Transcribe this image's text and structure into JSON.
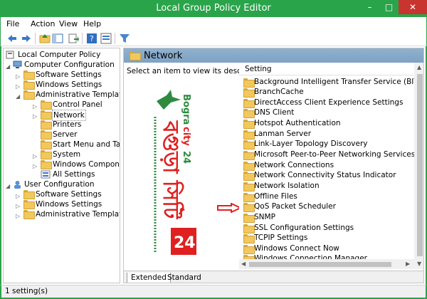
{
  "window": {
    "title": "Local Group Policy Editor",
    "minimize": "–",
    "maximize": "□",
    "close": "✕"
  },
  "menu": [
    {
      "label": "File"
    },
    {
      "label": "Action"
    },
    {
      "label": "View"
    },
    {
      "label": "Help"
    }
  ],
  "toolbar_icons": [
    "back-icon",
    "forward-icon",
    "up-folder-icon",
    "show-hide-tree-icon",
    "export-list-icon",
    "help-icon",
    "properties-icon",
    "filter-icon"
  ],
  "tree": {
    "root": "Local Computer Policy",
    "computer_config": "Computer Configuration",
    "cc_software": "Software Settings",
    "cc_windows": "Windows Settings",
    "cc_admin": "Administrative Templates",
    "control_panel": "Control Panel",
    "network": "Network",
    "printers": "Printers",
    "server": "Server",
    "start_menu": "Start Menu and Taskbar",
    "system": "System",
    "windows_components": "Windows Components",
    "all_settings": "All Settings",
    "user_config": "User Configuration",
    "uc_software": "Software Settings",
    "uc_windows": "Windows Settings",
    "uc_admin": "Administrative Templates"
  },
  "right": {
    "header": "Network",
    "description": "Select an item to view its description.",
    "column": "Setting",
    "settings": [
      "Background Intelligent Transfer Service (BITS)",
      "BranchCache",
      "DirectAccess Client Experience Settings",
      "DNS Client",
      "Hotspot Authentication",
      "Lanman Server",
      "Link-Layer Topology Discovery",
      "Microsoft Peer-to-Peer Networking Services",
      "Network Connections",
      "Network Connectivity Status Indicator",
      "Network Isolation",
      "Offline Files",
      "QoS Packet Scheduler",
      "SNMP",
      "SSL Configuration Settings",
      "TCPIP Settings",
      "Windows Connect Now",
      "Windows Connection Manager"
    ],
    "tabs": {
      "extended": "Extended",
      "standard": "Standard"
    }
  },
  "banner": {
    "brand": "Bogra",
    "brand_word": "city",
    "brand_num": "24",
    "bangla_title": "বগুড়া সিটি",
    "badge": "24"
  },
  "status": {
    "text": "1 setting(s)"
  },
  "colors": {
    "frame": "#2aa44a",
    "header": "#8fb0cf",
    "folder": "#f2c75c",
    "arrow": "#e02020"
  }
}
